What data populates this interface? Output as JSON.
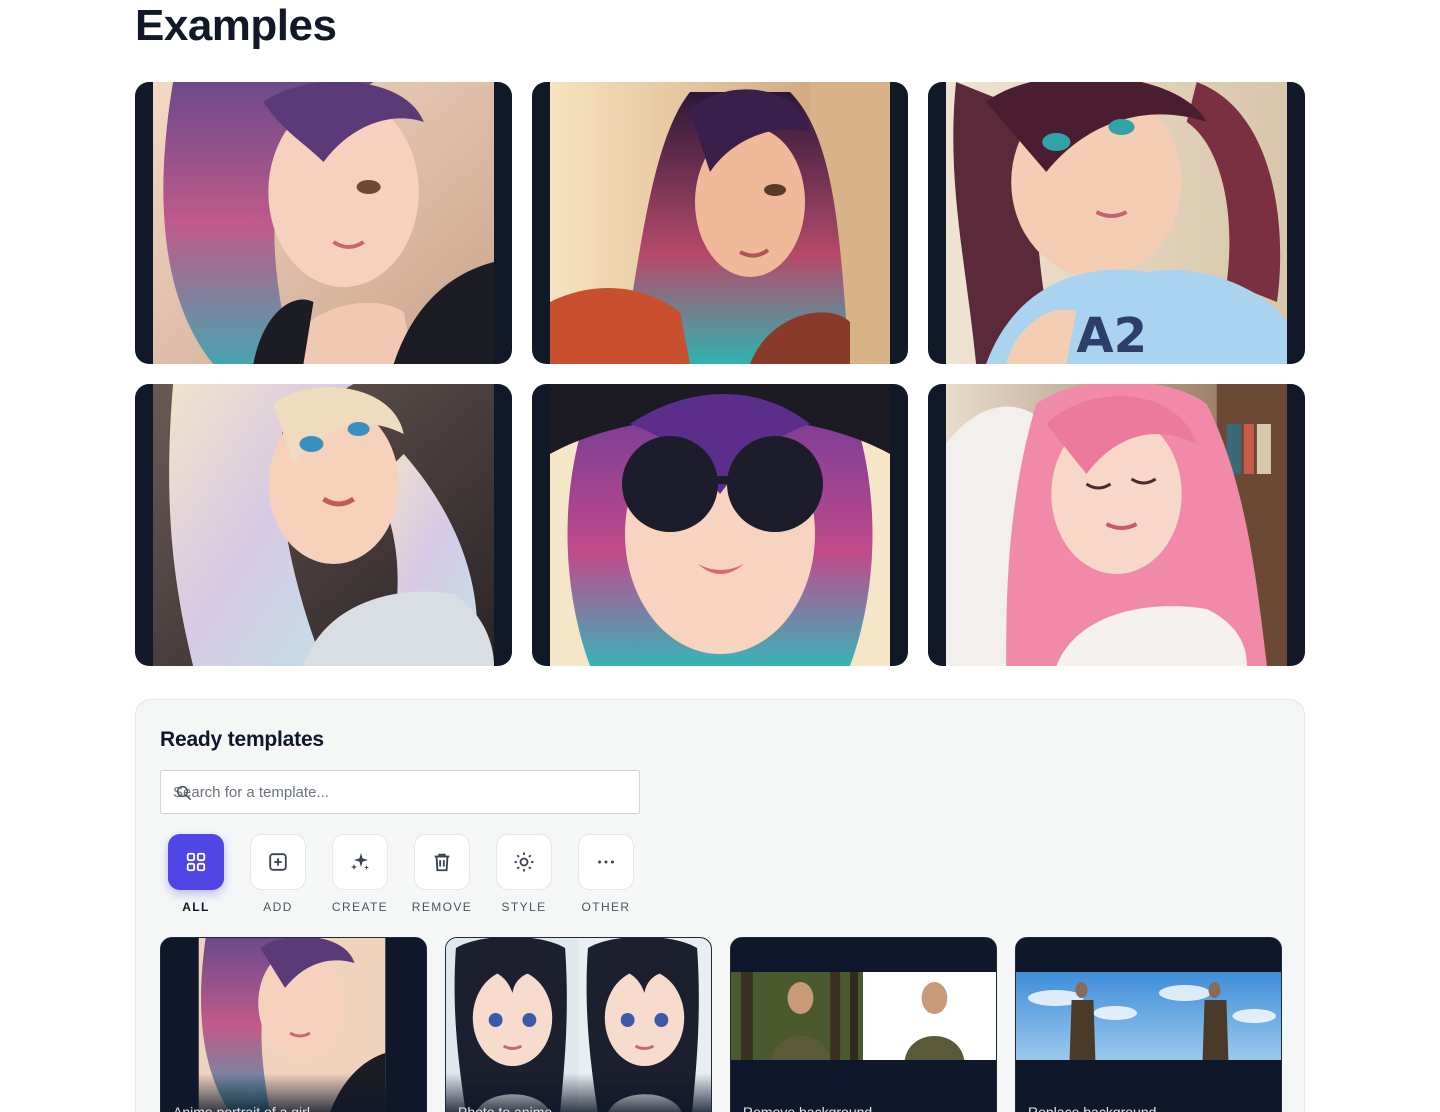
{
  "page": {
    "title": "Examples"
  },
  "examples": [
    {
      "icon": "anime-portrait-1"
    },
    {
      "icon": "anime-portrait-2"
    },
    {
      "icon": "anime-portrait-3"
    },
    {
      "icon": "anime-portrait-4"
    },
    {
      "icon": "anime-portrait-5"
    },
    {
      "icon": "anime-portrait-6"
    }
  ],
  "templates": {
    "title": "Ready templates",
    "search": {
      "placeholder": "Search for a template...",
      "value": ""
    },
    "categories": [
      {
        "label": "ALL",
        "icon": "grid-icon",
        "active": true
      },
      {
        "label": "ADD",
        "icon": "plus-square-icon",
        "active": false
      },
      {
        "label": "CREATE",
        "icon": "sparkles-icon",
        "active": false
      },
      {
        "label": "REMOVE",
        "icon": "trash-icon",
        "active": false
      },
      {
        "label": "STYLE",
        "icon": "sun-icon",
        "active": false
      },
      {
        "label": "OTHER",
        "icon": "more-icon",
        "active": false
      }
    ],
    "cards": [
      {
        "caption": "Anime portrait of a girl"
      },
      {
        "caption": "Photo to anime"
      },
      {
        "caption": "Remove background"
      },
      {
        "caption": "Replace background"
      }
    ]
  },
  "colors": {
    "accent": "#4f46e5",
    "card_bg": "#111827",
    "panel_bg": "#f5f7f7"
  }
}
